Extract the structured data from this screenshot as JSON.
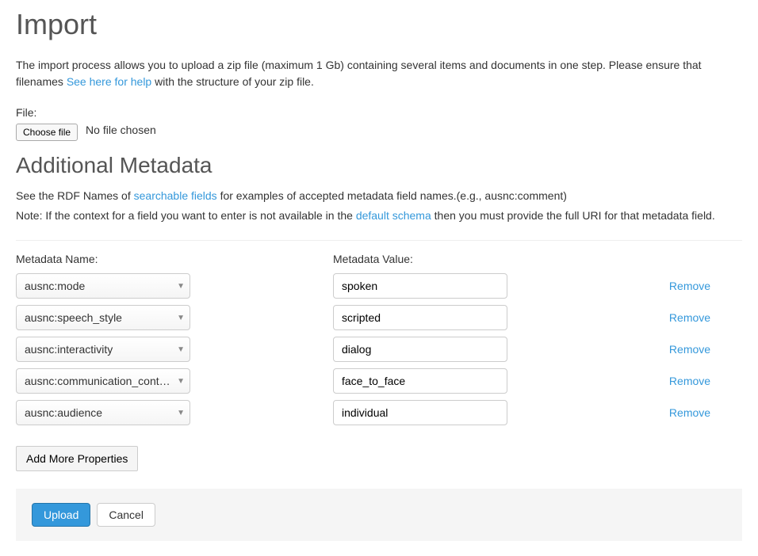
{
  "page_title": "Import",
  "intro_text_before_link": "The import process allows you to upload a zip file (maximum 1 Gb) containing several items and documents in one step. Please ensure that filenames ",
  "help_link": "See here for help",
  "intro_text_after_link": " with the structure of your zip file.",
  "file_label": "File:",
  "choose_file_label": "Choose file",
  "file_status": "No file chosen",
  "additional_metadata_heading": "Additional Metadata",
  "rdf_text_before": "See the RDF Names of ",
  "searchable_fields_link": "searchable fields",
  "rdf_text_after": " for examples of accepted metadata field names.(e.g., ausnc:comment)",
  "note_text_before": "Note: If the context for a field you want to enter is not available in the ",
  "default_schema_link": "default schema",
  "note_text_after": " then you must provide the full URI for that metadata field.",
  "metadata_name_header": "Metadata Name:",
  "metadata_value_header": "Metadata Value:",
  "rows": [
    {
      "name": "ausnc:mode",
      "value": "spoken"
    },
    {
      "name": "ausnc:speech_style",
      "value": "scripted"
    },
    {
      "name": "ausnc:interactivity",
      "value": "dialog"
    },
    {
      "name": "ausnc:communication_cont…",
      "value": "face_to_face"
    },
    {
      "name": "ausnc:audience",
      "value": "individual"
    }
  ],
  "remove_label": "Remove",
  "add_more_label": "Add More Properties",
  "upload_label": "Upload",
  "cancel_label": "Cancel"
}
